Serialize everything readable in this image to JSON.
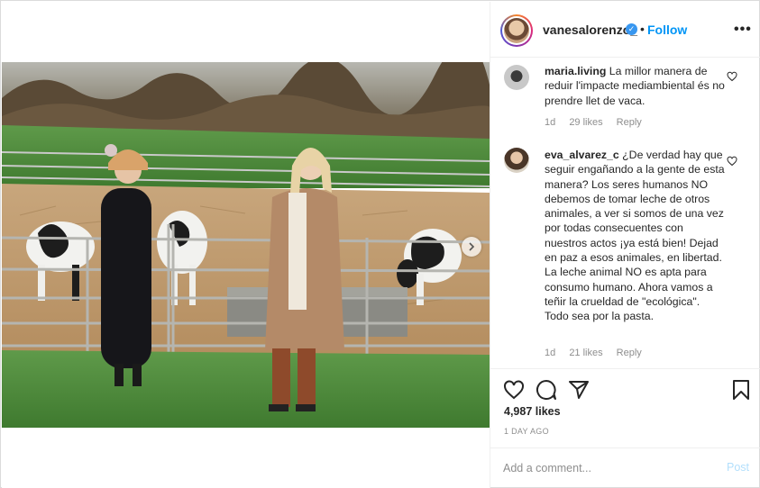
{
  "post": {
    "username": "vanesalorenzo_",
    "verified_mark": "✓",
    "separator": "•",
    "follow_label": "Follow",
    "more_label": "•••"
  },
  "comments": [
    {
      "username": "maria.living",
      "text": "La millor manera de reduir l'impacte mediambiental és no prendre llet de vaca.",
      "age": "1d",
      "likes": "29 likes",
      "reply_label": "Reply"
    },
    {
      "username": "eva_alvarez_c",
      "text": "¿De verdad hay que seguir engañando a la gente de esta manera? Los seres humanos NO debemos de tomar leche de otros animales, a ver si somos de una vez por todas consecuentes con nuestros actos ¡ya está bien! Dejad en paz a esos animales, en libertad. La leche animal NO es apta para consumo humano. Ahora vamos a teñir la crueldad de \"ecológica\". Todo sea por la pasta.",
      "age": "1d",
      "likes": "21 likes",
      "reply_label": "Reply"
    }
  ],
  "stats": {
    "likes": "4,987 likes",
    "date": "1 DAY AGO"
  },
  "add_comment": {
    "placeholder": "Add a comment...",
    "post_label": "Post"
  },
  "icons": [
    "heart-icon",
    "comment-icon",
    "share-icon",
    "bookmark-icon",
    "chevron-right-icon",
    "verified-icon"
  ],
  "colors": {
    "accent": "#0095f6",
    "post_disabled": "#b2dffc",
    "muted": "#8e8e8e",
    "text": "#262626",
    "border": "#efefef"
  }
}
